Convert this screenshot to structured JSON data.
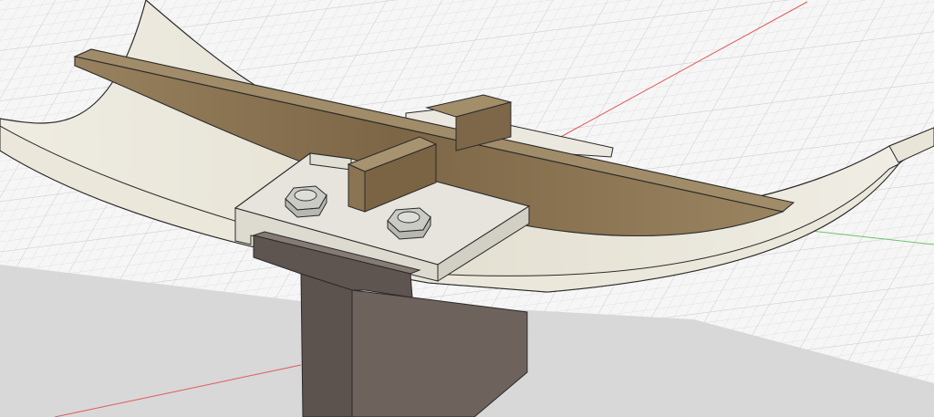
{
  "viewport": {
    "colors": {
      "background": "#f6f6f6",
      "grid_minor": "#dcdcdc",
      "grid_major": "#c4c4c4",
      "axis_red": "#e05a5a",
      "axis_green": "#6cc46c",
      "shadow": "#d4d4d4",
      "saddle": "#ece8dc",
      "saddle_edge": "#2a2a2a",
      "wood_top": "#9c8866",
      "wood_face": "#8a7250",
      "wood_light": "#b09a72",
      "plate": "#e8e6de",
      "plate_side": "#d6d3c8",
      "bolt": "#c8c8c4",
      "beam_front": "#5e5450",
      "beam_side": "#766a64",
      "beam_top": "#8a7e78"
    }
  },
  "model": {
    "components": [
      {
        "name": "saddle-shell",
        "icon": "curved-shell"
      },
      {
        "name": "wood-rib",
        "icon": "wood-board"
      },
      {
        "name": "cross-block",
        "icon": "wood-block"
      },
      {
        "name": "clamp-plate",
        "icon": "plate"
      },
      {
        "name": "hex-bolt-left",
        "icon": "hex-nut"
      },
      {
        "name": "hex-bolt-right",
        "icon": "hex-nut"
      },
      {
        "name": "t-beam",
        "icon": "steel-tee"
      }
    ]
  }
}
